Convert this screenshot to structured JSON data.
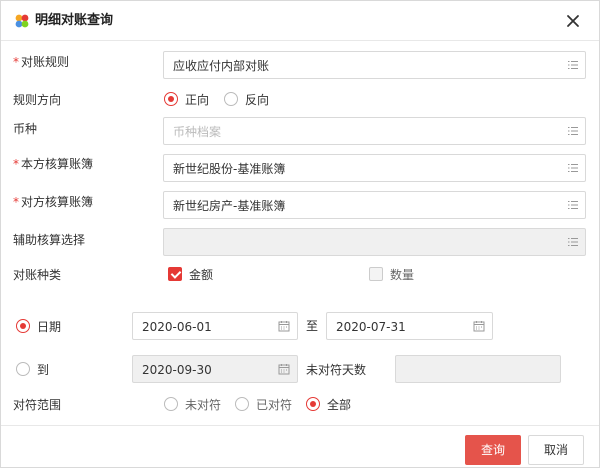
{
  "dialog": {
    "title": "明细对账查询",
    "close_icon": "close-icon",
    "logo_icon": "app-logo-icon"
  },
  "form": {
    "rule": {
      "label": "对账规则",
      "required": "*",
      "value": "应收应付内部对账"
    },
    "direction": {
      "label": "规则方向",
      "options": [
        "正向",
        "反向"
      ],
      "selected": "正向"
    },
    "currency": {
      "label": "币种",
      "placeholder": "币种档案",
      "value": ""
    },
    "own_book": {
      "label": "本方核算账簿",
      "required": "*",
      "value": "新世纪股份-基准账簿"
    },
    "other_book": {
      "label": "对方核算账簿",
      "required": "*",
      "value": "新世纪房产-基准账簿"
    },
    "aux": {
      "label": "辅助核算选择",
      "value": ""
    },
    "kind": {
      "label": "对账种类",
      "amount": "金额",
      "amount_checked": true,
      "quantity": "数量",
      "quantity_checked": false
    },
    "date_mode": {
      "label": "日期",
      "selected": true,
      "from": "2020-06-01",
      "to_label": "至",
      "to": "2020-07-31"
    },
    "until_mode": {
      "label": "到",
      "selected": false,
      "date": "2020-09-30",
      "days_label": "未对符天数",
      "days": ""
    },
    "match_scope": {
      "label": "对符范围",
      "options": [
        "未对符",
        "已对符",
        "全部"
      ],
      "selected": "全部"
    }
  },
  "footer": {
    "query_label": "查询",
    "cancel_label": "取消"
  },
  "colors": {
    "accent": "#e53935",
    "primary_button": "#e5544b",
    "border": "#d9d9d9",
    "disabled_bg": "#f0f0f0"
  }
}
